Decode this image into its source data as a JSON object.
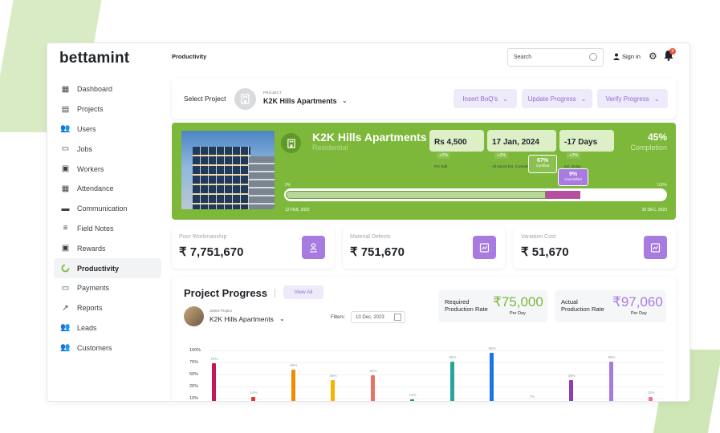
{
  "app": {
    "logo": "bettamint",
    "page_title": "Productivity"
  },
  "search": {
    "value": "Search"
  },
  "header": {
    "sign_in": "Sign in",
    "notif_count": "0"
  },
  "sidebar": {
    "items": [
      {
        "label": "Dashboard",
        "icon": "dashboard-icon"
      },
      {
        "label": "Projects",
        "icon": "projects-icon"
      },
      {
        "label": "Users",
        "icon": "users-icon"
      },
      {
        "label": "Jobs",
        "icon": "jobs-icon"
      },
      {
        "label": "Workers",
        "icon": "workers-icon"
      },
      {
        "label": "Attendance",
        "icon": "attendance-icon"
      },
      {
        "label": "Communication",
        "icon": "communication-icon"
      },
      {
        "label": "Field Notes",
        "icon": "field-notes-icon"
      },
      {
        "label": "Rewards",
        "icon": "rewards-icon"
      },
      {
        "label": "Productivity",
        "icon": "productivity-icon",
        "active": true
      },
      {
        "label": "Payments",
        "icon": "payments-icon"
      },
      {
        "label": "Reports",
        "icon": "reports-icon"
      },
      {
        "label": "Leads",
        "icon": "leads-icon"
      },
      {
        "label": "Customers",
        "icon": "customers-icon"
      }
    ]
  },
  "project_select": {
    "label": "Select Project",
    "tag": "PROJECT",
    "name": "K2K Hills Apartments",
    "buttons": [
      "Insert BoQ's",
      "Update Progress",
      "Verify Progress"
    ]
  },
  "hero": {
    "name": "K2K Hills Apartments",
    "type": "Residential",
    "stats": [
      {
        "value": "Rs 4,500",
        "badge": "+2%",
        "sub": "Per Sqft"
      },
      {
        "value": "17 Jan, 2024",
        "badge": "+2%",
        "sub": "All based Est. Completion"
      },
      {
        "value": "-17 Days",
        "badge": "+2%",
        "sub": "Est. Delay"
      }
    ],
    "completion_value": "45%",
    "completion_label": "Completion",
    "certified_pct": "67%",
    "certified_label": "Certified",
    "certified_fraction": 0.67,
    "uncertified_pct": "9%",
    "uncertified_label": "Uncertified",
    "uncertified_fraction": 0.09,
    "scale_start": "0%",
    "scale_end": "100%",
    "start_date": "12 FEB, 2022",
    "end_date": "30 DEC, 2023"
  },
  "kpis": [
    {
      "label": "Poor Workmanship",
      "value": "₹ 7,751,670",
      "icon": "upload-user-icon"
    },
    {
      "label": "Material Defects",
      "value": "₹ 751,670",
      "icon": "clipboard-chart-icon"
    },
    {
      "label": "Variation Cost",
      "value": "₹ 51,670",
      "icon": "clipboard-chart-icon"
    }
  ],
  "progress": {
    "title": "Project Progress",
    "view_all": "View All",
    "select_tag": "Select Project",
    "project_name": "K2K Hills Apartments",
    "filters_label": "Filters:",
    "date": "10 Dec, 2023",
    "required": {
      "label_1": "Required",
      "label_2": "Production Rate",
      "value": "₹75,000",
      "per": "Per Day"
    },
    "actual": {
      "label_1": "Actual",
      "label_2": "Production Rate",
      "value": "₹97,060",
      "per": "Per Day"
    }
  },
  "chart_data": {
    "type": "bar",
    "yticks": [
      "100%",
      "75%",
      "50%",
      "25%",
      "10%"
    ],
    "values": [
      76,
      14,
      65,
      45,
      54,
      10,
      80,
      95,
      7,
      45,
      80,
      15
    ],
    "labels": [
      "76%",
      "14%",
      "65%",
      "45%",
      "54%",
      "10%",
      "80%",
      "95%",
      "7%",
      "45%",
      "80%",
      "15%"
    ],
    "colors": [
      "#c2185b",
      "#e53935",
      "#ef8c00",
      "#f4b400",
      "#e57368",
      "#2e9b3e",
      "#26a69a",
      "#1a73e8",
      "#9e9e9e",
      "#8e3fb5",
      "#a77bdf",
      "#f06eaa"
    ],
    "ylim": [
      0,
      100
    ]
  },
  "colors": {
    "accent_green": "#7db83a",
    "accent_purple": "#a77bdf",
    "uncertified": "#b64fa0"
  }
}
